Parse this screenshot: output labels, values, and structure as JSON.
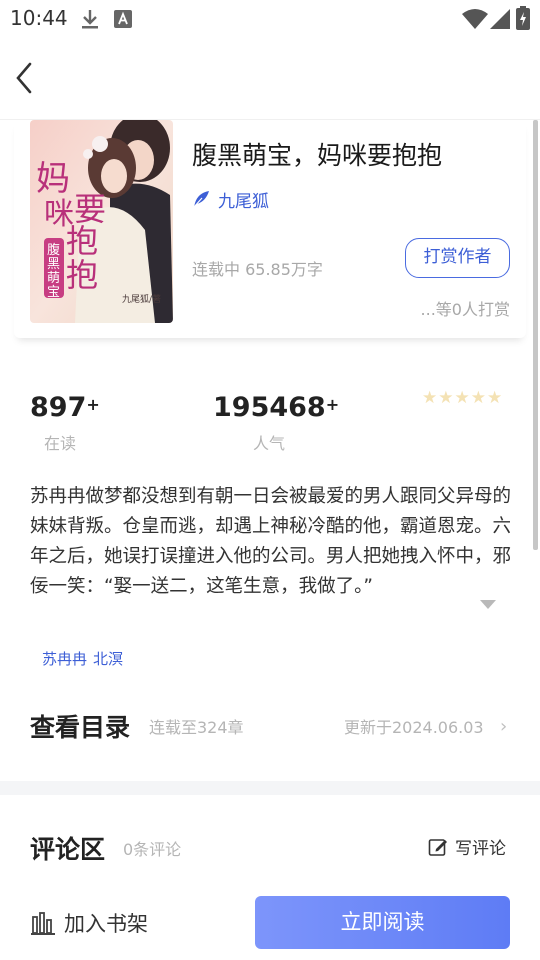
{
  "status_bar": {
    "time": "10:44",
    "icons": [
      "download-icon",
      "font-icon",
      "wifi-icon",
      "signal-icon",
      "battery-icon"
    ]
  },
  "nav": {
    "back_icon": "chevron-left-icon"
  },
  "book": {
    "title": "腹黑萌宝，妈咪要抱抱",
    "author_icon": "quill-icon",
    "author": "九尾狐",
    "status": "连载中 65.85万字",
    "tip_button": "打赏作者",
    "tip_count": "...等0人打赏",
    "cover": {
      "title_text": "妈咪要抱抱",
      "subtitle_text": "腹黑萌宝",
      "author_text": "九尾狐/著"
    }
  },
  "stats": {
    "readers": "897",
    "readers_suffix": "+",
    "readers_label": "在读",
    "popularity": "195468",
    "popularity_suffix": "+",
    "popularity_label": "人气",
    "rating": 5,
    "rating_max": 5,
    "star_color": "#f4e2b4"
  },
  "description": {
    "text": "苏冉冉做梦都没想到有朝一日会被最爱的男人跟同父异母的妹妹背叛。仓皇而逃，却遇上神秘冷酷的他，霸道恩宠。六年之后，她误打误撞进入他的公司。男人把她拽入怀中，邪佞一笑：“娶一送二，这笔生意，我做了。”",
    "expand_icon": "expand-down-icon",
    "tags": [
      "苏冉冉",
      "北溟"
    ]
  },
  "catalog": {
    "title": "查看目录",
    "progress": "连载至324章",
    "updated": "更新于2024.06.03",
    "chevron": "›"
  },
  "comments": {
    "title": "评论区",
    "count": "0条评论",
    "write_icon": "edit-icon",
    "write_label": "写评论"
  },
  "bottom_bar": {
    "shelf_icon": "bookshelf-icon",
    "shelf_label": "加入书架",
    "read_label": "立即阅读"
  },
  "colors": {
    "accent": "#3d5fd6",
    "read_button_start": "#7d95fb",
    "read_button_end": "#5e7cf5",
    "muted_text": "#b5b5b5"
  }
}
